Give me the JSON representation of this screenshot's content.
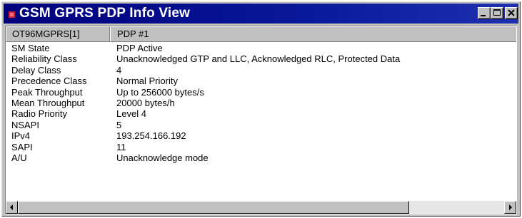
{
  "window": {
    "title": "GSM GPRS PDP Info View"
  },
  "header": {
    "col1": "OT96MGPRS[1]",
    "col2": "PDP #1"
  },
  "rows": [
    {
      "key": "SM State",
      "value": "PDP Active"
    },
    {
      "key": "Reliability Class",
      "value": "Unacknowledged GTP and LLC, Acknowledged RLC, Protected Data"
    },
    {
      "key": "Delay Class",
      "value": "4"
    },
    {
      "key": "Precedence Class",
      "value": "Normal Priority"
    },
    {
      "key": "Peak Throughput",
      "value": "Up to 256000 bytes/s"
    },
    {
      "key": "Mean Throughput",
      "value": "20000 bytes/h"
    },
    {
      "key": "Radio Priority",
      "value": "Level 4"
    },
    {
      "key": "NSAPI",
      "value": "5"
    },
    {
      "key": "IPv4",
      "value": "193.254.166.192"
    },
    {
      "key": "SAPI",
      "value": "11"
    },
    {
      "key": "A/U",
      "value": "Unacknowledge mode"
    }
  ],
  "icons": {
    "app": "app-icon",
    "minimize": "minimize-icon",
    "maximize": "maximize-icon",
    "close": "close-icon",
    "scroll_left": "arrow-left-icon",
    "scroll_right": "arrow-right-icon"
  },
  "colors": {
    "titlebar": "#00007b",
    "titlebar_text": "#ffffff",
    "chrome": "#c0c0c0",
    "content_bg": "#ffffff"
  }
}
